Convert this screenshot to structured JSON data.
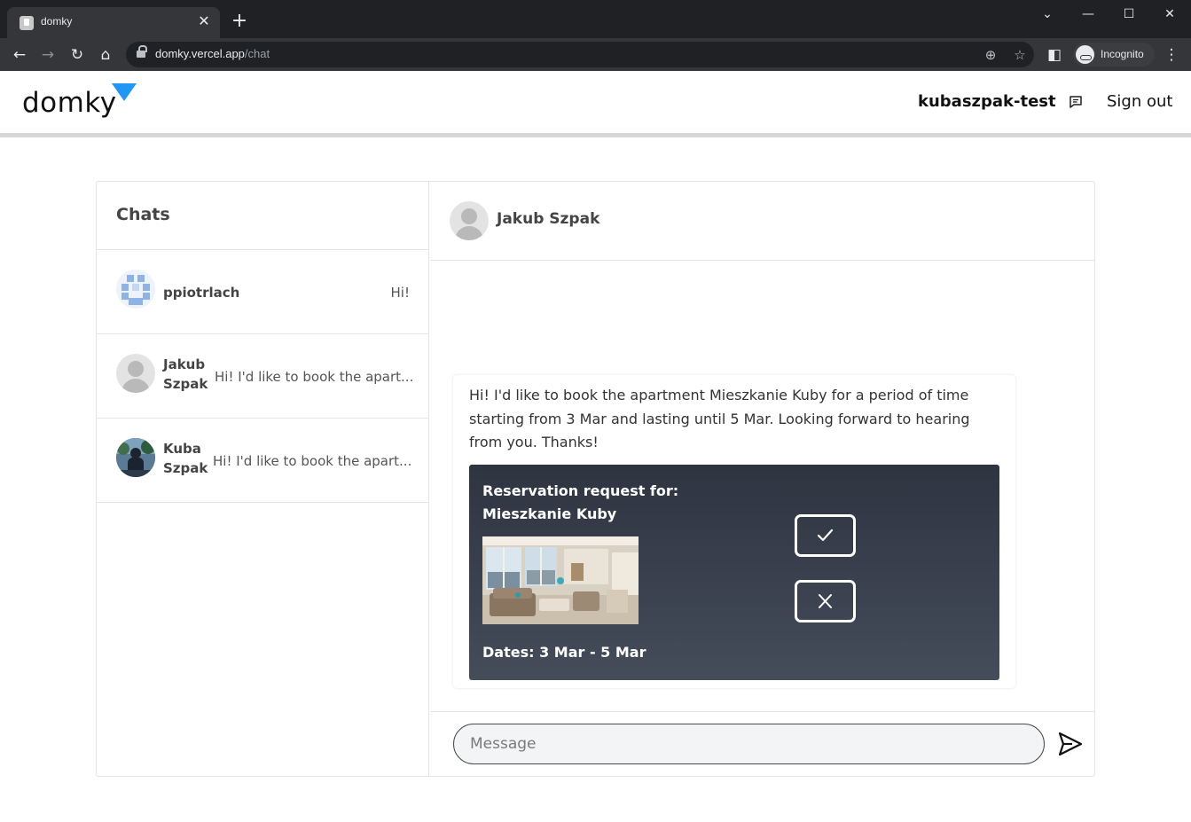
{
  "browser": {
    "tab_title": "domky",
    "url_host": "domky.vercel.app",
    "url_path": "/chat",
    "incognito_label": "Incognito"
  },
  "header": {
    "logo": "domky",
    "username": "kubaszpak-test",
    "signout_label": "Sign out"
  },
  "sidebar": {
    "title": "Chats",
    "chats": [
      {
        "name": "ppiotrlach",
        "preview": "Hi!"
      },
      {
        "name": "Jakub Szpak",
        "name_line1": "Jakub",
        "name_line2": "Szpak",
        "preview": "Hi! I'd like to book the apart..."
      },
      {
        "name": "Kuba Szpak",
        "name_line1": "Kuba",
        "name_line2": "Szpak",
        "preview": "Hi! I'd like to book the apart..."
      }
    ]
  },
  "conversation": {
    "contact_name": "Jakub Szpak",
    "message": "Hi! I'd like to book the apartment Mieszkanie Kuby for a period of time starting from 3 Mar and lasting until 5 Mar. Looking forward to hearing from you. Thanks!",
    "reservation": {
      "title_line1": "Reservation request for:",
      "title_line2": "Mieszkanie Kuby",
      "dates": "Dates: 3 Mar - 5 Mar"
    },
    "input_placeholder": "Message"
  },
  "colors": {
    "accent": "#2196f3",
    "card_dark": "#2e3440",
    "chrome_dark": "#202124"
  }
}
